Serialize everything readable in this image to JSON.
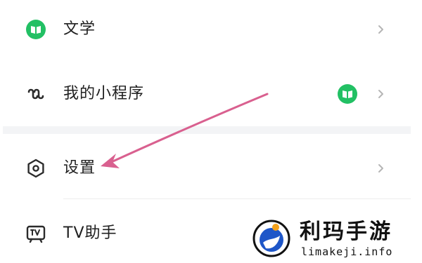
{
  "menu": {
    "items": [
      {
        "label": "文学",
        "icon": "book-icon",
        "has_badge": false
      },
      {
        "label": "我的小程序",
        "icon": "mini-program-icon",
        "has_badge": true,
        "badge_icon": "book-icon"
      },
      {
        "label": "设置",
        "icon": "settings-hexagon-icon",
        "has_badge": false
      },
      {
        "label": "TV助手",
        "icon": "tv-icon",
        "has_badge": false
      }
    ]
  },
  "annotation": {
    "arrow_color": "#d9608f",
    "target": "设置"
  },
  "colors": {
    "book_green": "#22c064",
    "icon_dark": "#2b2b2b",
    "chevron": "#b5b5b5",
    "section_gap": "#f3f4f6"
  },
  "watermark": {
    "title": "利玛手游",
    "subtitle": "limakeji.info"
  }
}
